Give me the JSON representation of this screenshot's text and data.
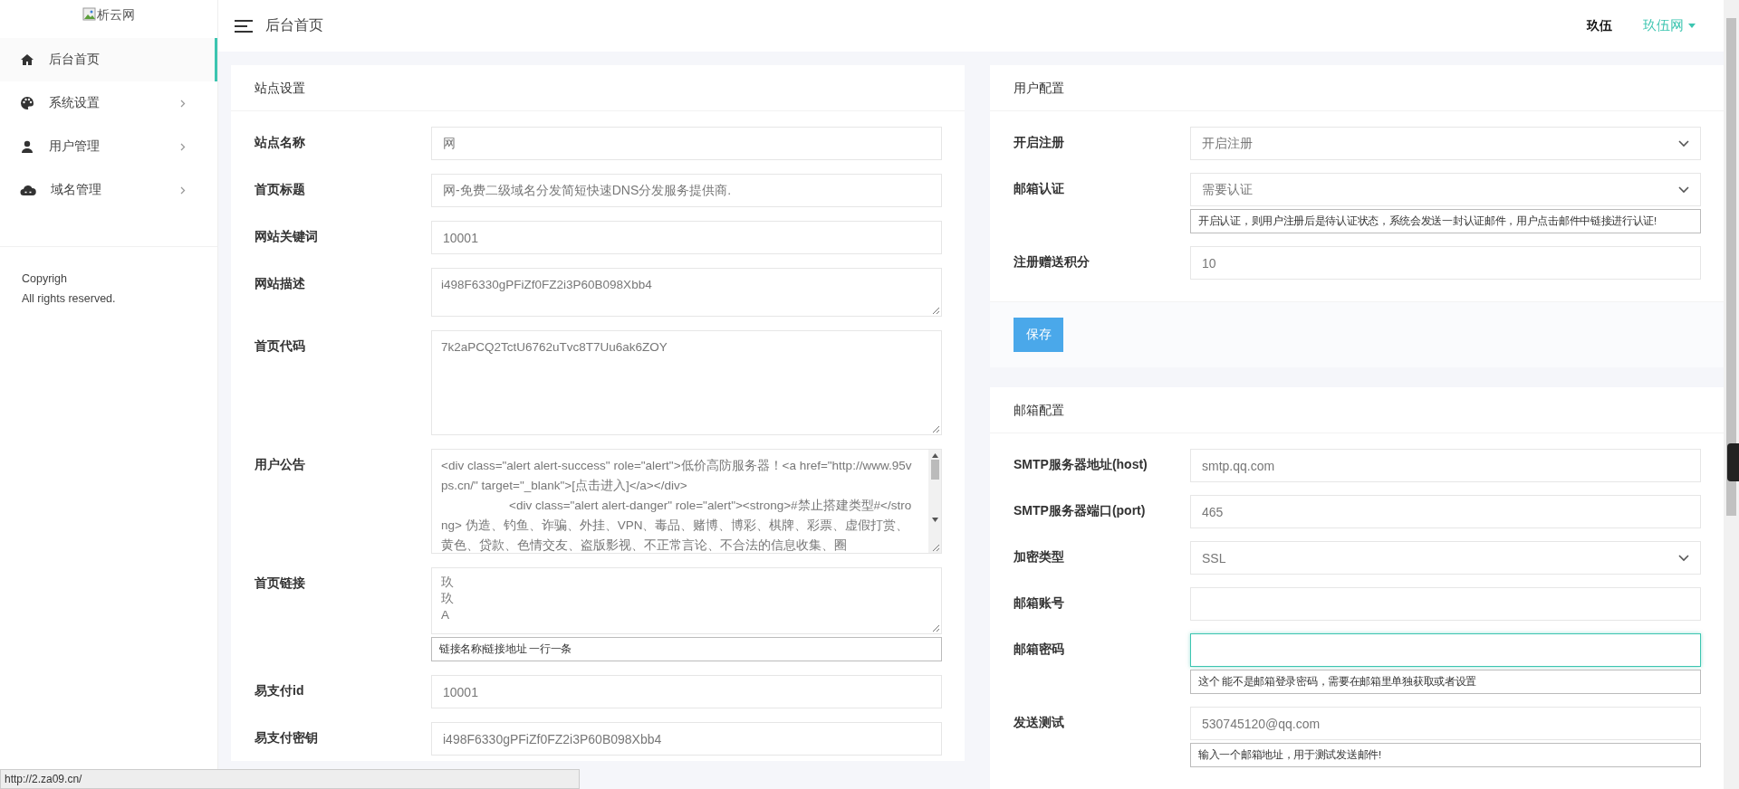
{
  "sidebar": {
    "logo_alt": "析云网",
    "nav": [
      {
        "label": "后台首页",
        "selected": true,
        "has_submenu": false
      },
      {
        "label": "系统设置",
        "selected": false,
        "has_submenu": true
      },
      {
        "label": "用户管理",
        "selected": false,
        "has_submenu": true
      },
      {
        "label": "域名管理",
        "selected": false,
        "has_submenu": true
      }
    ],
    "copyright": [
      "Copyrigh",
      "All rights reserved."
    ]
  },
  "header": {
    "title": "后台首页",
    "user": "玖伍",
    "site_menu": "玖伍网"
  },
  "site_settings": {
    "title": "站点设置",
    "fields": [
      {
        "label": "站点名称",
        "kind": "input",
        "value": "网"
      },
      {
        "label": "首页标题",
        "kind": "input",
        "value": "网-免费二级域名分发简短快速DNS分发服务提供商."
      },
      {
        "label": "网站关键词",
        "kind": "input",
        "value": "10001"
      },
      {
        "label": "网站描述",
        "kind": "textarea",
        "value": "i498F6330gPFiZf0FZ2i3P60B098Xbb4"
      },
      {
        "label": "首页代码",
        "kind": "textarea",
        "value": "7k2aPCQ2TctU6762uTvc8T7Uu6ak6ZOY"
      },
      {
        "label": "用户公告",
        "kind": "textarea",
        "value": "<div class=\"alert alert-success\" role=\"alert\">低价高防服务器！<a href=\"http://www.95vps.cn/\" target=\"_blank\">[点击进入]</a></div>\n                    <div class=\"alert alert-danger\" role=\"alert\"><strong>#禁止搭建类型#</strong> 伪造、钓鱼、诈骗、外挂、VPN、毒品、赌博、博彩、棋牌、彩票、虚假打赏、黄色、贷款、色情交友、盗版影视、不正常言论、不合法的信息收集、圈",
        "scrollable": true
      },
      {
        "label": "首页链接",
        "kind": "textarea",
        "lines": [
          "玖",
          "玖",
          "A"
        ],
        "help": "链接名称|链接地址 一行一条"
      },
      {
        "label": "易支付id",
        "kind": "input",
        "value": "10001"
      },
      {
        "label": "易支付密钥",
        "kind": "input",
        "value": "i498F6330gPFiZf0FZ2i3P60B098Xbb4"
      }
    ]
  },
  "user_settings": {
    "title": "用户配置",
    "fields": [
      {
        "label": "开启注册",
        "kind": "select",
        "value": "开启注册"
      },
      {
        "label": "邮箱认证",
        "kind": "select",
        "value": "需要认证",
        "help": "开启认证，则用户注册后是待认证状态，系统会发送一封认证邮件，用户点击邮件中链接进行认证!"
      },
      {
        "label": "注册赠送积分",
        "kind": "input",
        "value": "10"
      }
    ],
    "save_button": "保存"
  },
  "mail_settings": {
    "title": "邮箱配置",
    "fields": [
      {
        "label": "SMTP服务器地址(host)",
        "kind": "input",
        "value": "smtp.qq.com"
      },
      {
        "label": "SMTP服务器端口(port)",
        "kind": "input",
        "value": "465"
      },
      {
        "label": "加密类型",
        "kind": "select",
        "value": "SSL"
      },
      {
        "label": "邮箱账号",
        "kind": "input"
      },
      {
        "label": "邮箱密码",
        "kind": "input",
        "focused": true,
        "help": "这个 能不是邮箱登录密码，需要在邮箱里单独获取或者设置"
      },
      {
        "label": "发送测试",
        "kind": "input",
        "value": "530745120@qq.com",
        "help": "输入一个邮箱地址，用于测试发送邮件!"
      }
    ]
  },
  "status_bar": {
    "url": "http://2.za09.cn/"
  }
}
